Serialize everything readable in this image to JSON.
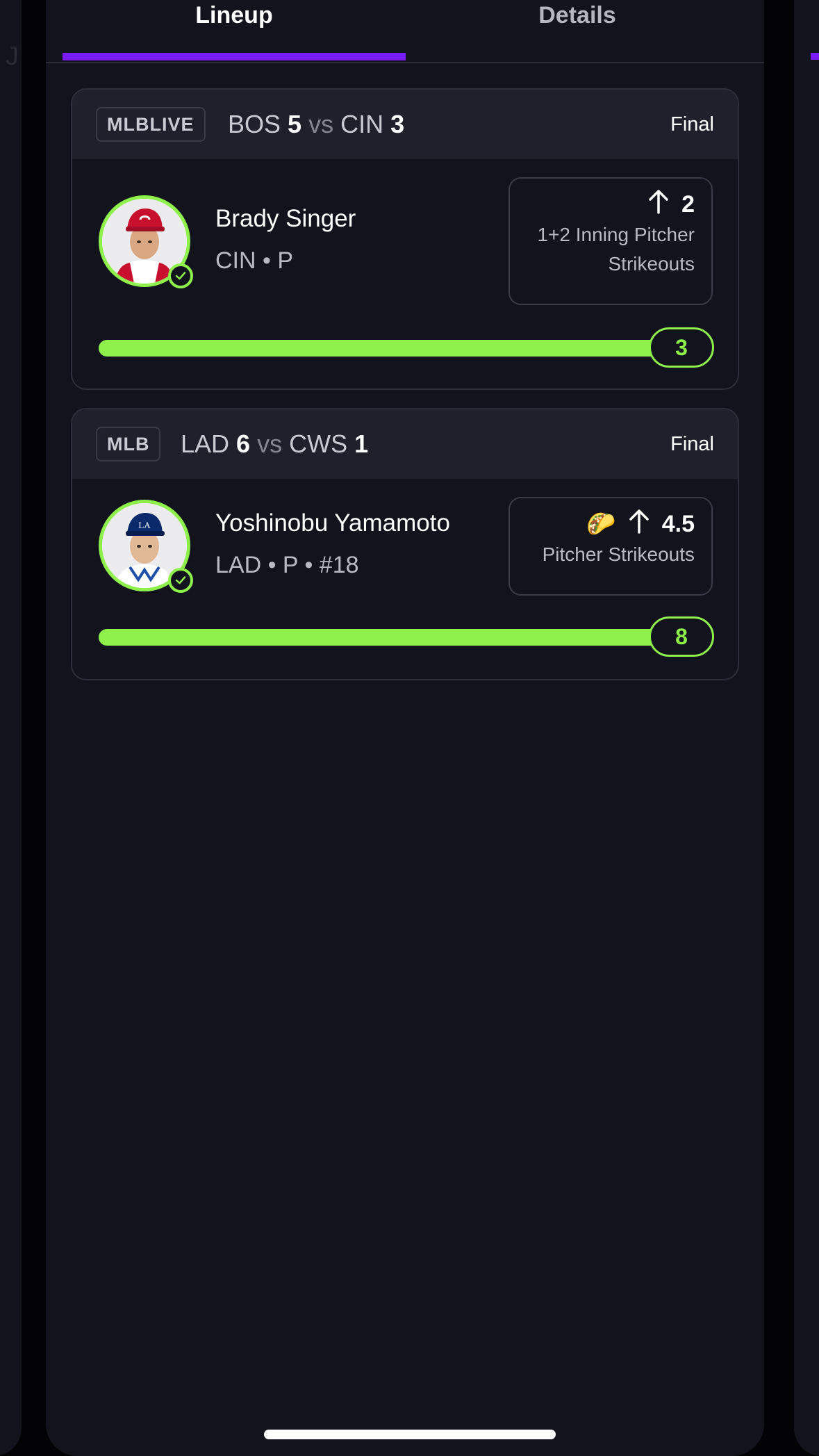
{
  "tabs": [
    {
      "label": "Lineup",
      "active": true
    },
    {
      "label": "Details",
      "active": false
    }
  ],
  "peek": {
    "left_letter": "J"
  },
  "colors": {
    "accent": "#7a1cf6",
    "success": "#8ef04a",
    "background": "#12131d",
    "header_bg": "#1f202b"
  },
  "cards": [
    {
      "league": "MLBLIVE",
      "away_team": "BOS",
      "away_score": "5",
      "vs": "vs",
      "home_team": "CIN",
      "home_score": "3",
      "status": "Final",
      "player": {
        "name": "Brady Singer",
        "meta": "CIN • P",
        "avatar_icon": "player-headshot-reds"
      },
      "prop": {
        "direction_icon": "arrow-up-icon",
        "line": "2",
        "label_line1": "1+2 Inning Pitcher",
        "label_line2": "Strikeouts"
      },
      "progress": {
        "value": "3",
        "fraction": 1.0
      }
    },
    {
      "league": "MLB",
      "away_team": "LAD",
      "away_score": "6",
      "vs": "vs",
      "home_team": "CWS",
      "home_score": "1",
      "status": "Final",
      "player": {
        "name": "Yoshinobu Yamamoto",
        "meta": "LAD • P • #18",
        "avatar_icon": "player-headshot-dodgers"
      },
      "prop": {
        "emoji": "🌮",
        "direction_icon": "arrow-up-icon",
        "line": "4.5",
        "label_line1": "Pitcher Strikeouts"
      },
      "progress": {
        "value": "8",
        "fraction": 1.0
      }
    }
  ]
}
